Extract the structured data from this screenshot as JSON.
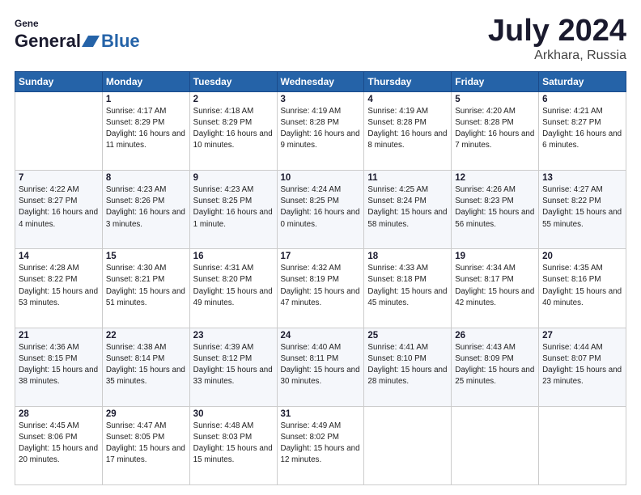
{
  "header": {
    "logo_general": "General",
    "logo_blue": "Blue",
    "title": "July 2024",
    "location": "Arkhara, Russia"
  },
  "weekdays": [
    "Sunday",
    "Monday",
    "Tuesday",
    "Wednesday",
    "Thursday",
    "Friday",
    "Saturday"
  ],
  "weeks": [
    [
      {
        "day": "",
        "sunrise": "",
        "sunset": "",
        "daylight": ""
      },
      {
        "day": "1",
        "sunrise": "Sunrise: 4:17 AM",
        "sunset": "Sunset: 8:29 PM",
        "daylight": "Daylight: 16 hours and 11 minutes."
      },
      {
        "day": "2",
        "sunrise": "Sunrise: 4:18 AM",
        "sunset": "Sunset: 8:29 PM",
        "daylight": "Daylight: 16 hours and 10 minutes."
      },
      {
        "day": "3",
        "sunrise": "Sunrise: 4:19 AM",
        "sunset": "Sunset: 8:28 PM",
        "daylight": "Daylight: 16 hours and 9 minutes."
      },
      {
        "day": "4",
        "sunrise": "Sunrise: 4:19 AM",
        "sunset": "Sunset: 8:28 PM",
        "daylight": "Daylight: 16 hours and 8 minutes."
      },
      {
        "day": "5",
        "sunrise": "Sunrise: 4:20 AM",
        "sunset": "Sunset: 8:28 PM",
        "daylight": "Daylight: 16 hours and 7 minutes."
      },
      {
        "day": "6",
        "sunrise": "Sunrise: 4:21 AM",
        "sunset": "Sunset: 8:27 PM",
        "daylight": "Daylight: 16 hours and 6 minutes."
      }
    ],
    [
      {
        "day": "7",
        "sunrise": "Sunrise: 4:22 AM",
        "sunset": "Sunset: 8:27 PM",
        "daylight": "Daylight: 16 hours and 4 minutes."
      },
      {
        "day": "8",
        "sunrise": "Sunrise: 4:23 AM",
        "sunset": "Sunset: 8:26 PM",
        "daylight": "Daylight: 16 hours and 3 minutes."
      },
      {
        "day": "9",
        "sunrise": "Sunrise: 4:23 AM",
        "sunset": "Sunset: 8:25 PM",
        "daylight": "Daylight: 16 hours and 1 minute."
      },
      {
        "day": "10",
        "sunrise": "Sunrise: 4:24 AM",
        "sunset": "Sunset: 8:25 PM",
        "daylight": "Daylight: 16 hours and 0 minutes."
      },
      {
        "day": "11",
        "sunrise": "Sunrise: 4:25 AM",
        "sunset": "Sunset: 8:24 PM",
        "daylight": "Daylight: 15 hours and 58 minutes."
      },
      {
        "day": "12",
        "sunrise": "Sunrise: 4:26 AM",
        "sunset": "Sunset: 8:23 PM",
        "daylight": "Daylight: 15 hours and 56 minutes."
      },
      {
        "day": "13",
        "sunrise": "Sunrise: 4:27 AM",
        "sunset": "Sunset: 8:22 PM",
        "daylight": "Daylight: 15 hours and 55 minutes."
      }
    ],
    [
      {
        "day": "14",
        "sunrise": "Sunrise: 4:28 AM",
        "sunset": "Sunset: 8:22 PM",
        "daylight": "Daylight: 15 hours and 53 minutes."
      },
      {
        "day": "15",
        "sunrise": "Sunrise: 4:30 AM",
        "sunset": "Sunset: 8:21 PM",
        "daylight": "Daylight: 15 hours and 51 minutes."
      },
      {
        "day": "16",
        "sunrise": "Sunrise: 4:31 AM",
        "sunset": "Sunset: 8:20 PM",
        "daylight": "Daylight: 15 hours and 49 minutes."
      },
      {
        "day": "17",
        "sunrise": "Sunrise: 4:32 AM",
        "sunset": "Sunset: 8:19 PM",
        "daylight": "Daylight: 15 hours and 47 minutes."
      },
      {
        "day": "18",
        "sunrise": "Sunrise: 4:33 AM",
        "sunset": "Sunset: 8:18 PM",
        "daylight": "Daylight: 15 hours and 45 minutes."
      },
      {
        "day": "19",
        "sunrise": "Sunrise: 4:34 AM",
        "sunset": "Sunset: 8:17 PM",
        "daylight": "Daylight: 15 hours and 42 minutes."
      },
      {
        "day": "20",
        "sunrise": "Sunrise: 4:35 AM",
        "sunset": "Sunset: 8:16 PM",
        "daylight": "Daylight: 15 hours and 40 minutes."
      }
    ],
    [
      {
        "day": "21",
        "sunrise": "Sunrise: 4:36 AM",
        "sunset": "Sunset: 8:15 PM",
        "daylight": "Daylight: 15 hours and 38 minutes."
      },
      {
        "day": "22",
        "sunrise": "Sunrise: 4:38 AM",
        "sunset": "Sunset: 8:14 PM",
        "daylight": "Daylight: 15 hours and 35 minutes."
      },
      {
        "day": "23",
        "sunrise": "Sunrise: 4:39 AM",
        "sunset": "Sunset: 8:12 PM",
        "daylight": "Daylight: 15 hours and 33 minutes."
      },
      {
        "day": "24",
        "sunrise": "Sunrise: 4:40 AM",
        "sunset": "Sunset: 8:11 PM",
        "daylight": "Daylight: 15 hours and 30 minutes."
      },
      {
        "day": "25",
        "sunrise": "Sunrise: 4:41 AM",
        "sunset": "Sunset: 8:10 PM",
        "daylight": "Daylight: 15 hours and 28 minutes."
      },
      {
        "day": "26",
        "sunrise": "Sunrise: 4:43 AM",
        "sunset": "Sunset: 8:09 PM",
        "daylight": "Daylight: 15 hours and 25 minutes."
      },
      {
        "day": "27",
        "sunrise": "Sunrise: 4:44 AM",
        "sunset": "Sunset: 8:07 PM",
        "daylight": "Daylight: 15 hours and 23 minutes."
      }
    ],
    [
      {
        "day": "28",
        "sunrise": "Sunrise: 4:45 AM",
        "sunset": "Sunset: 8:06 PM",
        "daylight": "Daylight: 15 hours and 20 minutes."
      },
      {
        "day": "29",
        "sunrise": "Sunrise: 4:47 AM",
        "sunset": "Sunset: 8:05 PM",
        "daylight": "Daylight: 15 hours and 17 minutes."
      },
      {
        "day": "30",
        "sunrise": "Sunrise: 4:48 AM",
        "sunset": "Sunset: 8:03 PM",
        "daylight": "Daylight: 15 hours and 15 minutes."
      },
      {
        "day": "31",
        "sunrise": "Sunrise: 4:49 AM",
        "sunset": "Sunset: 8:02 PM",
        "daylight": "Daylight: 15 hours and 12 minutes."
      },
      {
        "day": "",
        "sunrise": "",
        "sunset": "",
        "daylight": ""
      },
      {
        "day": "",
        "sunrise": "",
        "sunset": "",
        "daylight": ""
      },
      {
        "day": "",
        "sunrise": "",
        "sunset": "",
        "daylight": ""
      }
    ]
  ]
}
